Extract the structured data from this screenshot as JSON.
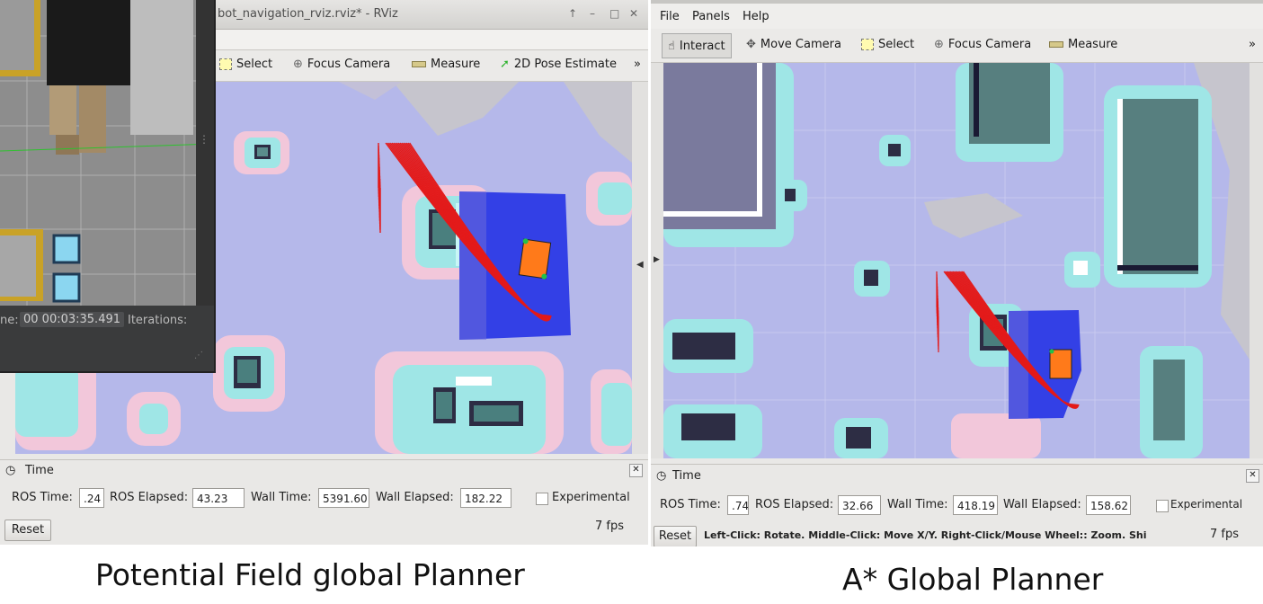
{
  "left": {
    "window_title": "bot_navigation_rviz.rviz* - RViz",
    "toolbar": {
      "select": "Select",
      "focus_camera": "Focus Camera",
      "measure": "Measure",
      "pose_estimate": "2D Pose Estimate",
      "overflow": "»"
    },
    "gazebo": {
      "sim_time_label": "ne:",
      "sim_time_value": "00 00:03:35.491",
      "iterations_label": "Iterations:"
    },
    "time_panel": {
      "title": "Time",
      "ros_time_label": "ROS Time:",
      "ros_time_value": ".24",
      "ros_elapsed_label": "ROS Elapsed:",
      "ros_elapsed_value": "43.23",
      "wall_time_label": "Wall Time:",
      "wall_time_value": "5391.60",
      "wall_elapsed_label": "Wall Elapsed:",
      "wall_elapsed_value": "182.22",
      "experimental_label": "Experimental",
      "reset": "Reset",
      "fps": "7 fps"
    },
    "caption": "Potential Field global Planner"
  },
  "right": {
    "menu": {
      "file": "File",
      "panels": "Panels",
      "help": "Help"
    },
    "toolbar": {
      "interact": "Interact",
      "move_camera": "Move Camera",
      "select": "Select",
      "focus_camera": "Focus Camera",
      "measure": "Measure",
      "overflow": "»"
    },
    "time_panel": {
      "title": "Time",
      "ros_time_label": "ROS Time:",
      "ros_time_value": ".74",
      "ros_elapsed_label": "ROS Elapsed:",
      "ros_elapsed_value": "32.66",
      "wall_time_label": "Wall Time:",
      "wall_time_value": "418.19",
      "wall_elapsed_label": "Wall Elapsed:",
      "wall_elapsed_value": "158.62",
      "experimental_label": "Experimental",
      "reset": "Reset",
      "status_hint": "Left-Click: Rotate. Middle-Click: Move X/Y. Right-Click/Mouse Wheel:: Zoom. Shi",
      "fps": "7 fps"
    },
    "caption": "A* Global Planner"
  },
  "colors": {
    "costmap_free": "#b5b8ea",
    "inflation": "#9fe6e6",
    "local_costmap": "#3340e6",
    "path_arrows": "#e31a1a",
    "robot": "#ff7a1a"
  }
}
